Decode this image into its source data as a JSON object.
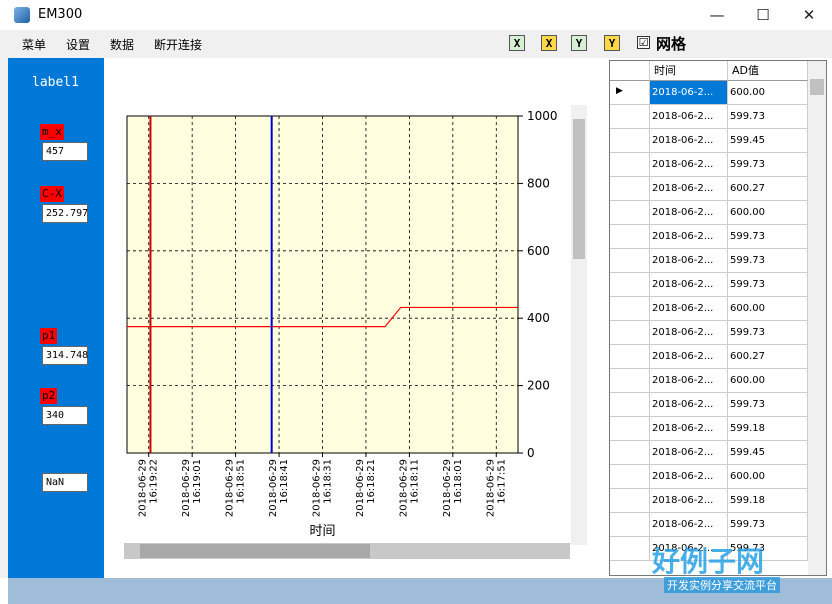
{
  "window": {
    "title": "EM300",
    "minimize": "—",
    "maximize": "☐",
    "close": "✕"
  },
  "menu": [
    "菜单",
    "设置",
    "数据",
    "断开连接"
  ],
  "toolbar": {
    "buttons": [
      "X",
      "X",
      "Y",
      "Y"
    ],
    "grid_checked": "☑",
    "grid_label": "网格"
  },
  "sidebar": {
    "label": "label1",
    "fields": [
      {
        "tag": "m_x",
        "value": "457"
      },
      {
        "tag": "C-X",
        "value": "252.797"
      },
      {
        "tag": "p1",
        "value": "314.748"
      },
      {
        "tag": "p2",
        "value": "340"
      },
      {
        "tag": "",
        "value": "NaN"
      }
    ]
  },
  "chart_data": {
    "type": "line",
    "xlabel": "时间",
    "ylabel": "",
    "ylim": [
      0,
      1000
    ],
    "yticks": [
      "0",
      "200",
      "400",
      "600",
      "800",
      "1000"
    ],
    "x_ticks": [
      "2018-06-29 16:19:22",
      "2018-06-29 16:19:01",
      "2018-06-29 16:18:51",
      "2018-06-29 16:18:41",
      "2018-06-29 16:18:31",
      "2018-06-29 16:18:21",
      "2018-06-29 16:18:11",
      "2018-06-29 16:18:01",
      "2018-06-29 16:17:51"
    ],
    "grid": true,
    "background": "#ffffe0",
    "series": [
      {
        "color": "#ff0000",
        "x_frac": [
          0,
          0.66,
          0.7,
          1
        ],
        "values": [
          375,
          375,
          432,
          432
        ]
      }
    ],
    "cursors": [
      {
        "color": "#cc0000",
        "x_frac": 0.06
      },
      {
        "color": "#0000cc",
        "x_frac": 0.37
      }
    ]
  },
  "table": {
    "columns": [
      "时间",
      "AD值"
    ],
    "rows": [
      [
        "2018-06-2...",
        "600.00"
      ],
      [
        "2018-06-2...",
        "599.73"
      ],
      [
        "2018-06-2...",
        "599.45"
      ],
      [
        "2018-06-2...",
        "599.73"
      ],
      [
        "2018-06-2...",
        "600.27"
      ],
      [
        "2018-06-2...",
        "600.00"
      ],
      [
        "2018-06-2...",
        "599.73"
      ],
      [
        "2018-06-2...",
        "599.73"
      ],
      [
        "2018-06-2...",
        "599.73"
      ],
      [
        "2018-06-2...",
        "600.00"
      ],
      [
        "2018-06-2...",
        "599.73"
      ],
      [
        "2018-06-2...",
        "600.27"
      ],
      [
        "2018-06-2...",
        "600.00"
      ],
      [
        "2018-06-2...",
        "599.73"
      ],
      [
        "2018-06-2...",
        "599.18"
      ],
      [
        "2018-06-2...",
        "599.45"
      ],
      [
        "2018-06-2...",
        "600.00"
      ],
      [
        "2018-06-2...",
        "599.18"
      ],
      [
        "2018-06-2...",
        "599.73"
      ],
      [
        "2018-06-2...",
        "599.73"
      ]
    ]
  },
  "watermark": {
    "main": "好例子网",
    "sub": "开发实例分享交流平台"
  }
}
